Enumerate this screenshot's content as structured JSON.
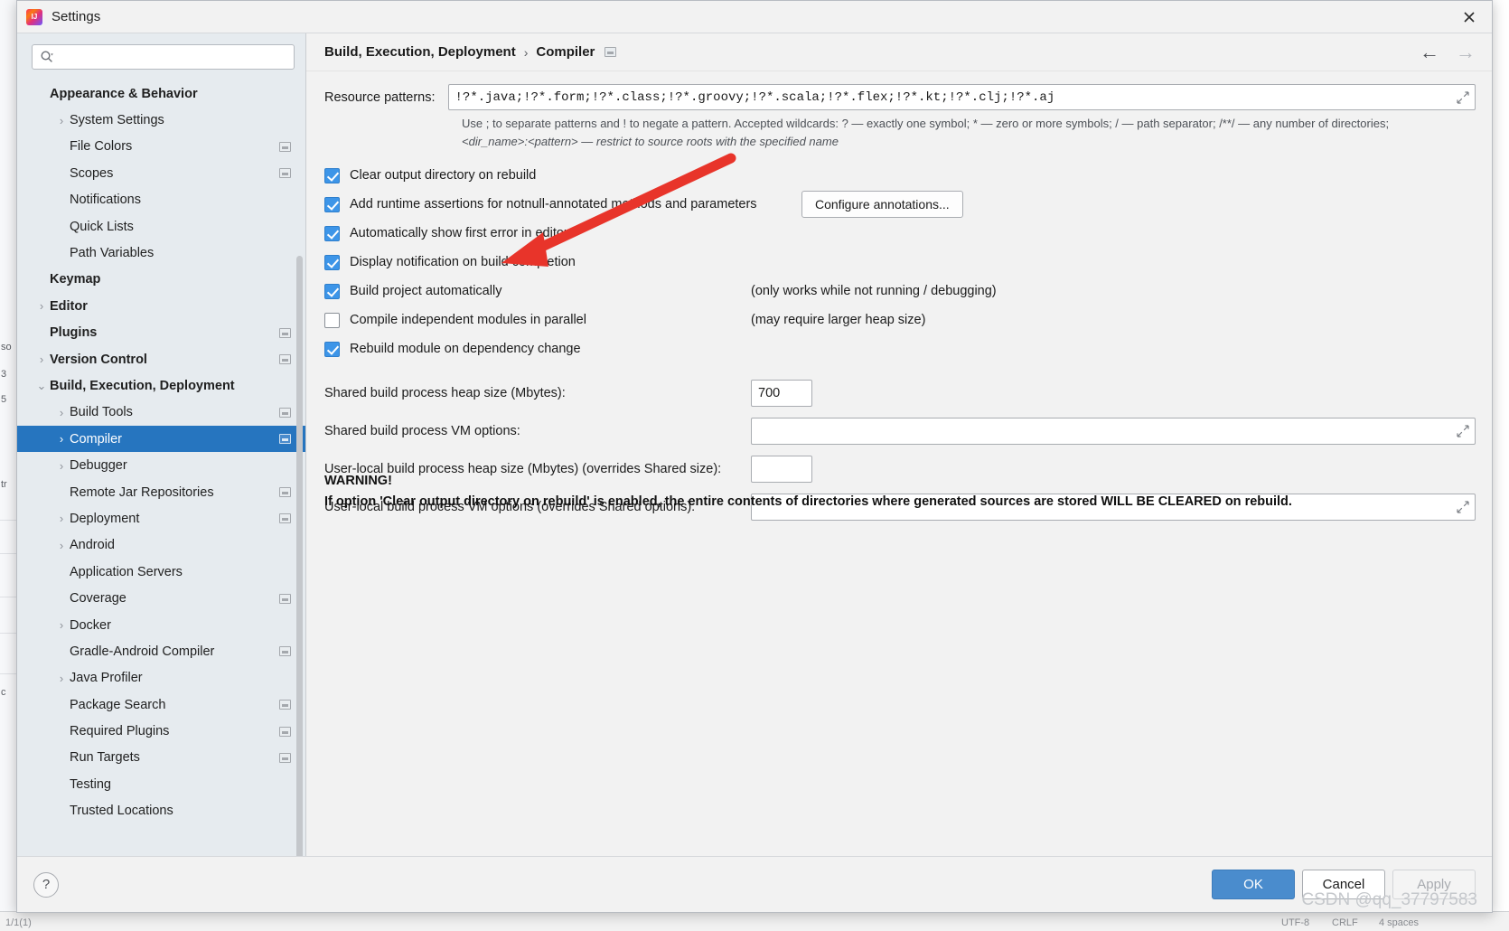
{
  "window": {
    "title": "Settings",
    "app_icon": "intellij-idea-icon",
    "close_icon": "close-icon"
  },
  "search": {
    "value": "",
    "placeholder": "",
    "icon": "search-icon"
  },
  "sidebar": {
    "scrollbar": "vertical-scrollbar",
    "items": [
      {
        "label": "Appearance & Behavior",
        "indent": 0,
        "bold": true,
        "arrow": "",
        "badge": false,
        "selected": false
      },
      {
        "label": "System Settings",
        "indent": 1,
        "bold": false,
        "arrow": "right",
        "badge": false,
        "selected": false
      },
      {
        "label": "File Colors",
        "indent": 1,
        "bold": false,
        "arrow": "",
        "badge": true,
        "selected": false
      },
      {
        "label": "Scopes",
        "indent": 1,
        "bold": false,
        "arrow": "",
        "badge": true,
        "selected": false
      },
      {
        "label": "Notifications",
        "indent": 1,
        "bold": false,
        "arrow": "",
        "badge": false,
        "selected": false
      },
      {
        "label": "Quick Lists",
        "indent": 1,
        "bold": false,
        "arrow": "",
        "badge": false,
        "selected": false
      },
      {
        "label": "Path Variables",
        "indent": 1,
        "bold": false,
        "arrow": "",
        "badge": false,
        "selected": false
      },
      {
        "label": "Keymap",
        "indent": 0,
        "bold": true,
        "arrow": "",
        "badge": false,
        "selected": false
      },
      {
        "label": "Editor",
        "indent": 0,
        "bold": true,
        "arrow": "right",
        "badge": false,
        "selected": false
      },
      {
        "label": "Plugins",
        "indent": 0,
        "bold": true,
        "arrow": "",
        "badge": true,
        "selected": false
      },
      {
        "label": "Version Control",
        "indent": 0,
        "bold": true,
        "arrow": "right",
        "badge": true,
        "selected": false
      },
      {
        "label": "Build, Execution, Deployment",
        "indent": 0,
        "bold": true,
        "arrow": "down",
        "badge": false,
        "selected": false
      },
      {
        "label": "Build Tools",
        "indent": 1,
        "bold": false,
        "arrow": "right",
        "badge": true,
        "selected": false
      },
      {
        "label": "Compiler",
        "indent": 1,
        "bold": false,
        "arrow": "right",
        "badge": true,
        "selected": true
      },
      {
        "label": "Debugger",
        "indent": 1,
        "bold": false,
        "arrow": "right",
        "badge": false,
        "selected": false
      },
      {
        "label": "Remote Jar Repositories",
        "indent": 1,
        "bold": false,
        "arrow": "",
        "badge": true,
        "selected": false
      },
      {
        "label": "Deployment",
        "indent": 1,
        "bold": false,
        "arrow": "right",
        "badge": true,
        "selected": false
      },
      {
        "label": "Android",
        "indent": 1,
        "bold": false,
        "arrow": "right",
        "badge": false,
        "selected": false
      },
      {
        "label": "Application Servers",
        "indent": 1,
        "bold": false,
        "arrow": "",
        "badge": false,
        "selected": false
      },
      {
        "label": "Coverage",
        "indent": 1,
        "bold": false,
        "arrow": "",
        "badge": true,
        "selected": false
      },
      {
        "label": "Docker",
        "indent": 1,
        "bold": false,
        "arrow": "right",
        "badge": false,
        "selected": false
      },
      {
        "label": "Gradle-Android Compiler",
        "indent": 1,
        "bold": false,
        "arrow": "",
        "badge": true,
        "selected": false
      },
      {
        "label": "Java Profiler",
        "indent": 1,
        "bold": false,
        "arrow": "right",
        "badge": false,
        "selected": false
      },
      {
        "label": "Package Search",
        "indent": 1,
        "bold": false,
        "arrow": "",
        "badge": true,
        "selected": false
      },
      {
        "label": "Required Plugins",
        "indent": 1,
        "bold": false,
        "arrow": "",
        "badge": true,
        "selected": false
      },
      {
        "label": "Run Targets",
        "indent": 1,
        "bold": false,
        "arrow": "",
        "badge": true,
        "selected": false
      },
      {
        "label": "Testing",
        "indent": 1,
        "bold": false,
        "arrow": "",
        "badge": false,
        "selected": false
      },
      {
        "label": "Trusted Locations",
        "indent": 1,
        "bold": false,
        "arrow": "",
        "badge": false,
        "selected": false
      }
    ]
  },
  "breadcrumb": {
    "root": "Build, Execution, Deployment",
    "separator": "›",
    "leaf": "Compiler",
    "badge_icon": "project-scope-icon",
    "back_icon": "arrow-left-icon",
    "forward_icon": "arrow-right-icon"
  },
  "main": {
    "resource_patterns": {
      "label": "Resource patterns:",
      "value": "!?*.java;!?*.form;!?*.class;!?*.groovy;!?*.scala;!?*.flex;!?*.kt;!?*.clj;!?*.aj",
      "expand_icon": "expand-icon"
    },
    "hint_line1": "Use ; to separate patterns and ! to negate a pattern. Accepted wildcards: ? — exactly one symbol; * — zero or more symbols; / — path separator; /**/ — any number of directories;",
    "hint_line2": "<dir_name>:<pattern> — restrict to source roots with the specified name",
    "checkboxes": [
      {
        "label": "Clear output directory on rebuild",
        "checked": true,
        "mnemonic": "l",
        "note": ""
      },
      {
        "label": "Add runtime assertions for notnull-annotated methods and parameters",
        "checked": true,
        "mnemonic": "a",
        "note": "",
        "button": "Configure annotations..."
      },
      {
        "label": "Automatically show first error in editor",
        "checked": true,
        "mnemonic": "e",
        "note": ""
      },
      {
        "label": "Display notification on build completion",
        "checked": true,
        "mnemonic": "",
        "note": ""
      },
      {
        "label": "Build project automatically",
        "checked": true,
        "mnemonic": "",
        "note": "(only works while not running / debugging)"
      },
      {
        "label": "Compile independent modules in parallel",
        "checked": false,
        "mnemonic": "",
        "note": "(may require larger heap size)"
      },
      {
        "label": "Rebuild module on dependency change",
        "checked": true,
        "mnemonic": "",
        "note": ""
      }
    ],
    "configure_annotations_button": "Configure annotations...",
    "fields": [
      {
        "label": "Shared build process heap size (Mbytes):",
        "value": "700",
        "wide": false
      },
      {
        "label": "Shared build process VM options:",
        "value": "",
        "wide": true
      },
      {
        "label": "User-local build process heap size (Mbytes) (overrides Shared size):",
        "value": "",
        "wide": false
      },
      {
        "label": "User-local build process VM options (overrides Shared options):",
        "value": "",
        "wide": true
      }
    ],
    "warning_title": "WARNING!",
    "warning_body": "If option 'Clear output directory on rebuild' is enabled, the entire contents of directories where generated sources are stored WILL BE CLEARED on rebuild.",
    "annotation_arrow": "red-arrow-annotation"
  },
  "footer": {
    "help_label": "?",
    "ok_label": "OK",
    "cancel_label": "Cancel",
    "apply_label": "Apply"
  },
  "watermark": "CSDN @qq_37797583",
  "backdrop": {
    "left_fragments": [
      "so",
      "3",
      "5",
      "tr",
      "c"
    ],
    "bottom_fragments": [
      "1/1(1)",
      "UTF-8",
      "CRLF",
      "4 spaces"
    ]
  },
  "colors": {
    "accent": "#2675bf",
    "checkbox_on": "#3d95e8",
    "primary_button": "#4a8ccd",
    "annotation_red": "#e8342a",
    "sidebar_bg": "#e6ebef",
    "panel_bg": "#f2f2f2"
  }
}
